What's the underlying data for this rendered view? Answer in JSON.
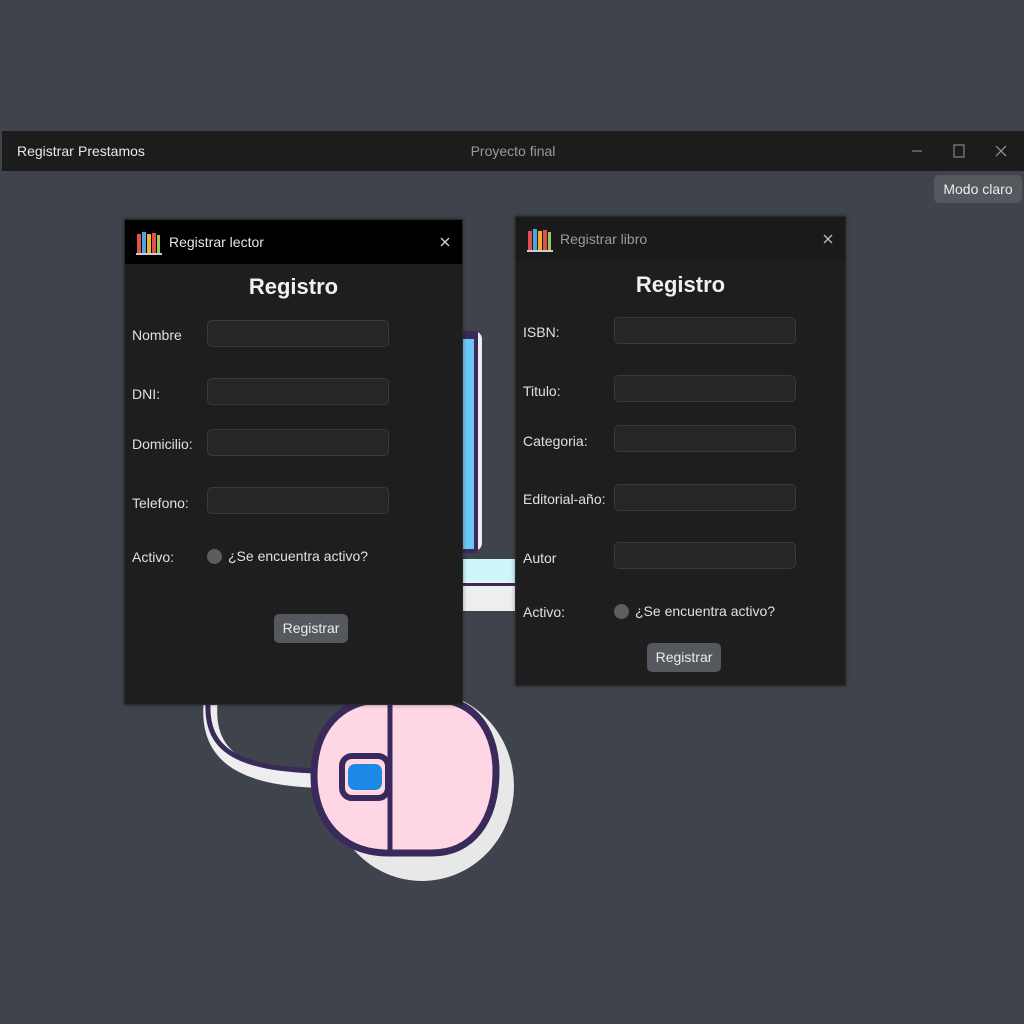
{
  "app": {
    "title": "Proyecto final",
    "menu": [
      "Registrar",
      "Prestamos"
    ],
    "theme_button": "Modo claro"
  },
  "colors": {
    "background": "#3f434b",
    "titlebar": "#1c1c1c",
    "panel": "#1e1e1e",
    "button": "#55585d",
    "mouse_pink": "#ffd6e3",
    "mouse_outline": "#3a2a5c",
    "accent_blue": "#1e88e5"
  },
  "reader_window": {
    "title": "Registrar lector",
    "heading": "Registro",
    "fields": [
      {
        "label": "Nombre",
        "value": ""
      },
      {
        "label": "DNI:",
        "value": ""
      },
      {
        "label": "Domicilio:",
        "value": ""
      },
      {
        "label": "Telefono:",
        "value": ""
      }
    ],
    "active_label": "Activo:",
    "active_option": "¿Se encuentra activo?",
    "submit": "Registrar"
  },
  "book_window": {
    "title": "Registrar libro",
    "heading": "Registro",
    "fields": [
      {
        "label": "ISBN:",
        "value": ""
      },
      {
        "label": "Titulo:",
        "value": ""
      },
      {
        "label": "Categoria:",
        "value": ""
      },
      {
        "label": "Editorial-año:",
        "value": ""
      },
      {
        "label": "Autor",
        "value": ""
      }
    ],
    "active_label": "Activo:",
    "active_option": "¿Se encuentra activo?",
    "submit": "Registrar"
  },
  "icons": [
    "books-icon",
    "minimize-icon",
    "maximize-icon",
    "close-icon"
  ]
}
